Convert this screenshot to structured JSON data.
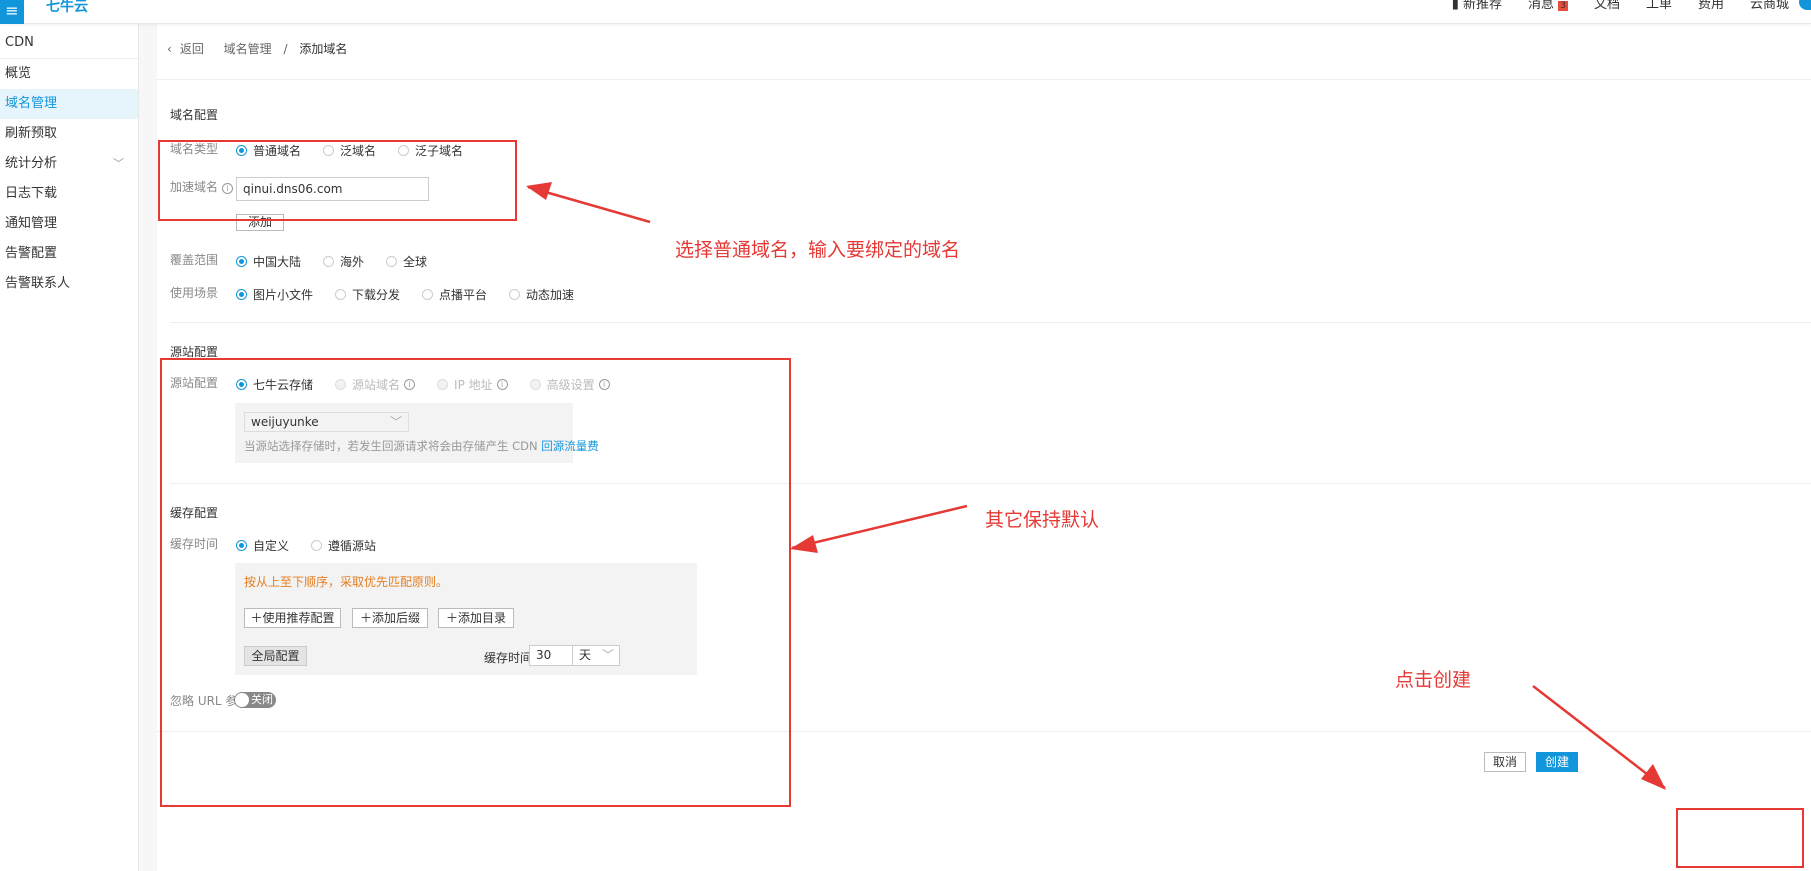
{
  "topbar": {
    "logo": "七牛云",
    "nav": [
      {
        "label": "新推荐",
        "highlight": true
      },
      {
        "label": "消息",
        "badge": "3"
      },
      {
        "label": "文档"
      },
      {
        "label": "工单"
      },
      {
        "label": "费用"
      },
      {
        "label": "云商城"
      }
    ]
  },
  "sidebar": {
    "title": "CDN",
    "items": [
      {
        "label": "概览"
      },
      {
        "label": "域名管理",
        "active": true
      },
      {
        "label": "刷新预取"
      },
      {
        "label": "统计分析",
        "expandable": true
      },
      {
        "label": "日志下载"
      },
      {
        "label": "通知管理"
      },
      {
        "label": "告警配置"
      },
      {
        "label": "告警联系人"
      }
    ]
  },
  "breadcrumb": {
    "back": "返回",
    "parent": "域名管理",
    "sep": "/",
    "current": "添加域名"
  },
  "domain_cfg": {
    "title": "域名配置",
    "type": {
      "label": "域名类型",
      "options": [
        "普通域名",
        "泛域名",
        "泛子域名"
      ],
      "selected": 0
    },
    "accel": {
      "label": "加速域名",
      "value": "qinui.dns06.com",
      "add": "添加"
    },
    "coverage": {
      "label": "覆盖范围",
      "options": [
        "中国大陆",
        "海外",
        "全球"
      ],
      "selected": 0
    },
    "scene": {
      "label": "使用场景",
      "options": [
        "图片小文件",
        "下载分发",
        "点播平台",
        "动态加速"
      ],
      "selected": 0
    }
  },
  "origin_cfg": {
    "title": "源站配置",
    "label": "源站配置",
    "options": [
      "七牛云存储",
      "源站域名",
      "IP 地址",
      "高级设置"
    ],
    "selected": 0,
    "bucket": "weijuyunke",
    "note": "当源站选择存储时，若发生回源请求将会由存储产生 CDN",
    "note_link": "回源流量费"
  },
  "cache_cfg": {
    "title": "缓存配置",
    "label": "缓存时间",
    "options": [
      "自定义",
      "遵循源站"
    ],
    "selected": 0,
    "hint": "按从上至下顺序，采取优先匹配原则。",
    "buttons": [
      "使用推荐配置",
      "添加后缀",
      "添加目录"
    ],
    "global": "全局配置",
    "time_label": "缓存时间",
    "time_value": "30",
    "time_unit": "天",
    "ignore_label": "忽略 URL 参数",
    "toggle": "关闭"
  },
  "footer": {
    "cancel": "取消",
    "create": "创建"
  },
  "annotations": {
    "a1": "选择普通域名，输入要绑定的域名",
    "a2": "其它保持默认",
    "a3": "点击创建"
  },
  "colors": {
    "accent": "#1296db",
    "annotation": "#e53935",
    "hint": "#e67e22"
  }
}
